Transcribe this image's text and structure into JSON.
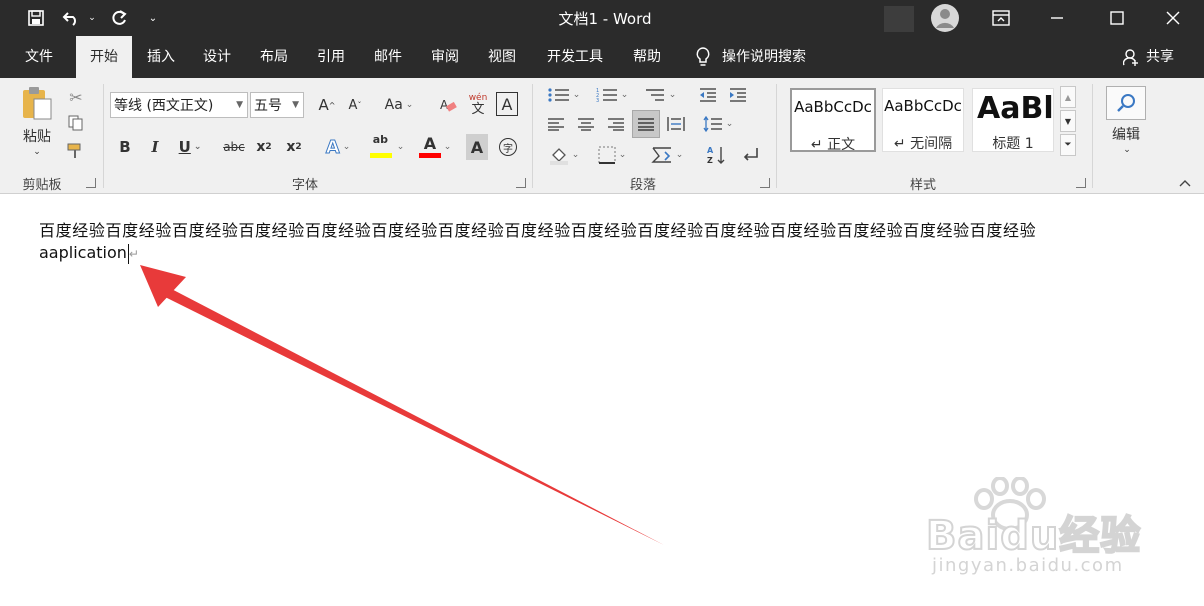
{
  "window": {
    "title": "文档1 - Word",
    "share_label": "共享"
  },
  "tabs": [
    "文件",
    "开始",
    "插入",
    "设计",
    "布局",
    "引用",
    "邮件",
    "审阅",
    "视图",
    "开发工具",
    "帮助"
  ],
  "active_tab": "开始",
  "tell_me": "操作说明搜索",
  "ribbon": {
    "clipboard": {
      "paste_label": "粘贴",
      "group_label": "剪贴板"
    },
    "font": {
      "font_name": "等线 (西文正文)",
      "font_size": "五号",
      "group_label": "字体",
      "phonetic_top": "wén",
      "phonetic_bottom": "文",
      "enclose_char": "字"
    },
    "paragraph": {
      "group_label": "段落"
    },
    "styles": {
      "group_label": "样式",
      "items": [
        {
          "sample": "AaBbCcDc",
          "name": "↵ 正文"
        },
        {
          "sample": "AaBbCcDc",
          "name": "↵ 无间隔"
        },
        {
          "sample": "AaBl",
          "name": "标题 1"
        }
      ]
    },
    "editing": {
      "label": "编辑"
    }
  },
  "document": {
    "line1": "百度经验百度经验百度经验百度经验百度经验百度经验百度经验百度经验百度经验百度经验百度经验百度经验百度经验百度经验百度经验",
    "line2": "aaplication",
    "para_mark": "↵"
  },
  "watermark": {
    "brand": "Baidu经验",
    "url": "jingyan.baidu.com"
  },
  "colors": {
    "titlebar": "#2b2b2b",
    "ribbon": "#f0f0f0",
    "highlight": "#ffff00",
    "font_color": "#ff0000",
    "arrow": "#e83a3a"
  }
}
